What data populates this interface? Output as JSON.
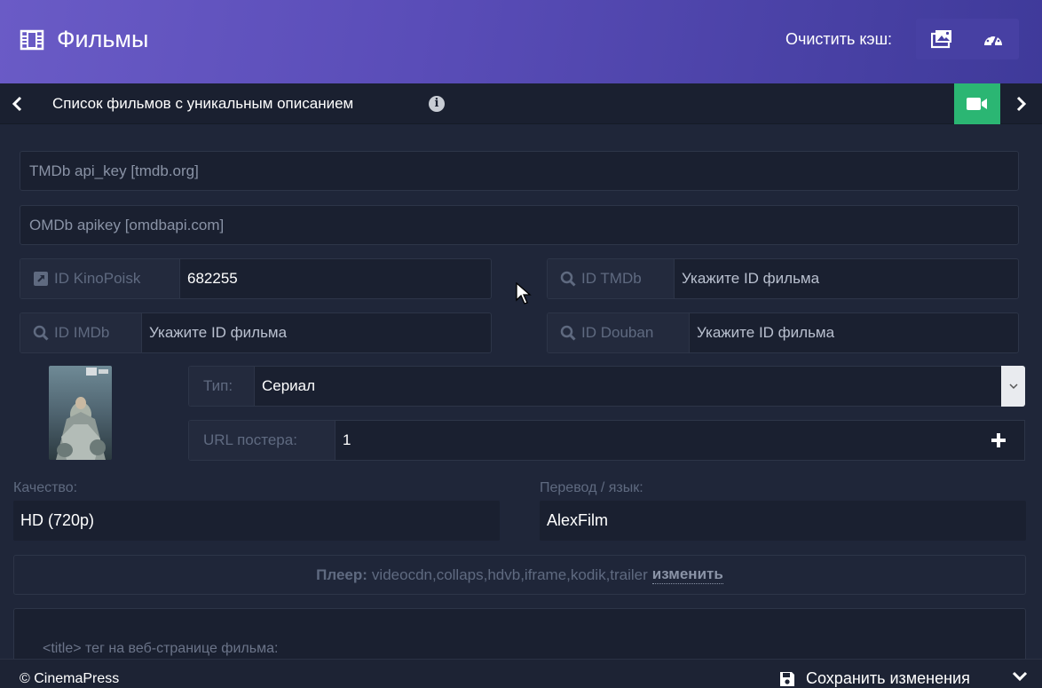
{
  "header": {
    "title": "Фильмы",
    "clear_cache_label": "Очистить кэш:",
    "cache_buttons": [
      {
        "icon": "image-icon"
      },
      {
        "icon": "dashboard-icon"
      }
    ]
  },
  "subnav": {
    "title": "Список фильмов с уникальным описанием",
    "info_glyph": "i"
  },
  "form": {
    "tmdb_api_key": {
      "placeholder": "TMDb api_key [tmdb.org]"
    },
    "omdb_api_key": {
      "placeholder": "OMDb apikey [omdbapi.com]"
    },
    "kinopoisk": {
      "label": "ID KinoPoisk",
      "value": "682255"
    },
    "tmdb_id": {
      "label": "ID TMDb",
      "placeholder": "Укажите ID фильма"
    },
    "imdb_id": {
      "label": "ID IMDb",
      "placeholder": "Укажите ID фильма"
    },
    "douban_id": {
      "label": "ID Douban",
      "placeholder": "Укажите ID фильма"
    },
    "type": {
      "label": "Тип:",
      "value": "Сериал"
    },
    "poster_url": {
      "label": "URL постера:",
      "value": "1"
    },
    "quality": {
      "label": "Качество:",
      "value": "HD (720p)"
    },
    "translation": {
      "label": "Перевод / язык:",
      "value": "AlexFilm"
    },
    "player": {
      "label": "Плеер:",
      "value": "videocdn,collaps,hdvb,iframe,kodik,trailer",
      "change": "изменить"
    },
    "title_tag_hint": "<title> тег на веб-странице фильма:"
  },
  "footer": {
    "copyright": "© CinemaPress",
    "save_label": "Сохранить изменения"
  },
  "colors": {
    "header_start": "#6a5bc6",
    "header_end": "#3f3a9a",
    "background": "#1f2639",
    "accent_green": "#2bb673"
  }
}
